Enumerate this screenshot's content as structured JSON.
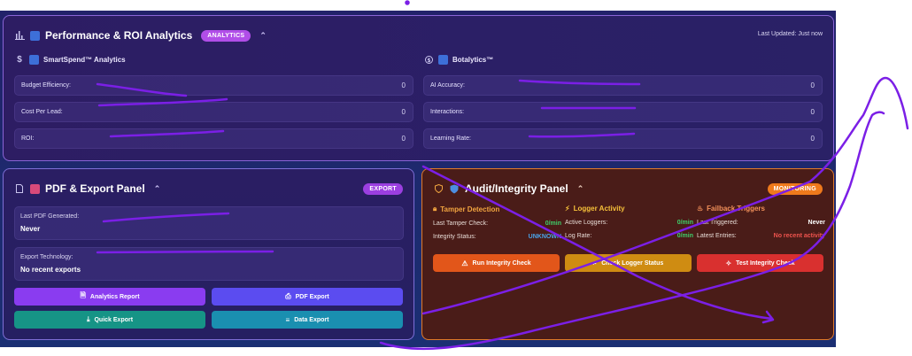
{
  "performance": {
    "title": "Performance & ROI Analytics",
    "badge": "ANALYTICS",
    "last_updated": "Last Updated: Just now",
    "smartspend": {
      "title": "SmartSpend™ Analytics",
      "rows": [
        {
          "label": "Budget Efficiency:",
          "value": "0"
        },
        {
          "label": "Cost Per Lead:",
          "value": "0"
        },
        {
          "label": "ROI:",
          "value": "0"
        }
      ]
    },
    "botalytics": {
      "title": "Botalytics™",
      "rows": [
        {
          "label": "AI Accuracy:",
          "value": "0"
        },
        {
          "label": "Interactions:",
          "value": "0"
        },
        {
          "label": "Learning Rate:",
          "value": "0"
        }
      ]
    }
  },
  "pdf": {
    "title": "PDF & Export Panel",
    "badge": "EXPORT",
    "last_pdf_label": "Last PDF Generated:",
    "last_pdf_value": "Never",
    "export_tech_label": "Export Technology:",
    "export_tech_value": "No recent exports",
    "buttons": {
      "analytics_report": "Analytics Report",
      "pdf_export": "PDF Export",
      "quick_export": "Quick Export",
      "data_export": "Data Export"
    }
  },
  "audit": {
    "title": "Audit/Integrity Panel",
    "badge": "MONITORING",
    "tamper": {
      "title": "Tamper Detection",
      "rows": [
        {
          "label": "Last Tamper Check:",
          "value": "0/min"
        },
        {
          "label": "Integrity Status:",
          "value": "UNKNOWN"
        }
      ]
    },
    "logger": {
      "title": "Logger Activity",
      "rows": [
        {
          "label": "Active Loggers:",
          "value": "0/min"
        },
        {
          "label": "Log Rate:",
          "value": "0/min"
        }
      ]
    },
    "failback": {
      "title": "Failback Triggers",
      "rows": [
        {
          "label": "Last Triggered:",
          "value": "Never"
        },
        {
          "label": "Latest Entries:",
          "value": "No recent activity"
        }
      ]
    },
    "buttons": {
      "run_integrity": "Run Integrity Check",
      "check_logger": "Check Logger Status",
      "test_integrity": "Test Integrity Check"
    }
  },
  "colors": {
    "analytics_badge": "#b14ee8",
    "export_badge": "#9b3fe0",
    "monitoring_badge": "#ef7a1c",
    "btn_purple": "#8a3cf0",
    "btn_indigo": "#5b4cf0",
    "btn_teal": "#169486",
    "btn_cyan": "#1a8fb0",
    "btn_orange": "#e2561a",
    "btn_amber": "#cf8c12",
    "btn_red": "#d9302f",
    "scribble": "#7b1fe6"
  }
}
